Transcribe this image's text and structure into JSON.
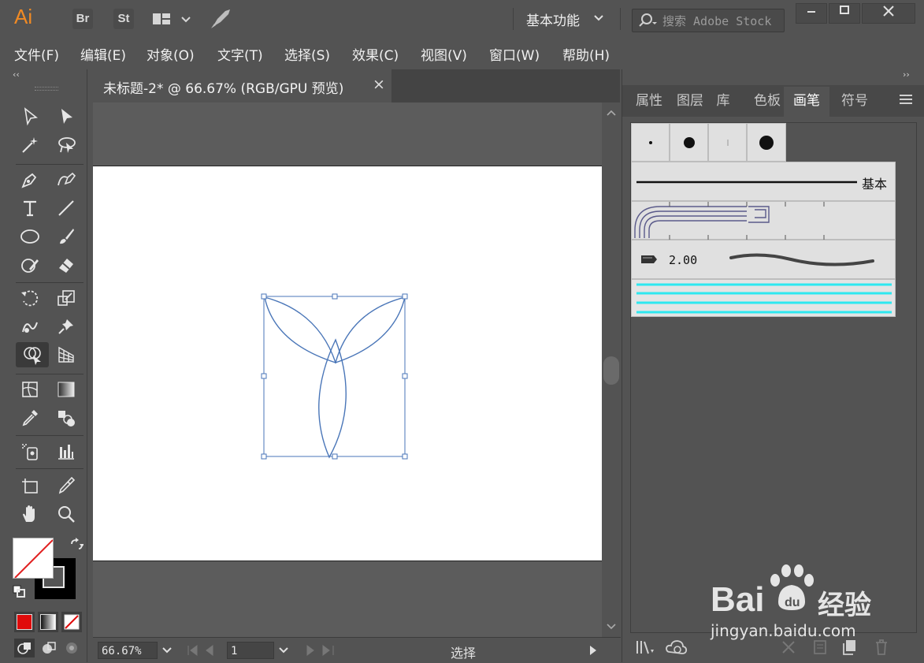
{
  "app": {
    "logo": "Ai",
    "bridge_label": "Br",
    "stock_label": "St",
    "workspace": "基本功能",
    "search_placeholder": "搜索 Adobe Stock"
  },
  "menu": [
    "文件(F)",
    "编辑(E)",
    "对象(O)",
    "文字(T)",
    "选择(S)",
    "效果(C)",
    "视图(V)",
    "窗口(W)",
    "帮助(H)"
  ],
  "document": {
    "tab_title": "未标题-2* @ 66.67% (RGB/GPU 预览)",
    "close_symbol": "×"
  },
  "status": {
    "zoom": "66.67%",
    "artboard_number": "1",
    "tool_name": "选择"
  },
  "panel": {
    "tabs": [
      "属性",
      "图层",
      "库",
      "色板",
      "画笔",
      "符号"
    ],
    "active_tab": "画笔",
    "basic_brush_label": "基本",
    "art_brush_size": "2.00"
  },
  "watermark": {
    "brand": "Bai",
    "brand2": "经验",
    "url": "jingyan.baidu.com"
  },
  "colors": {
    "accent_orange": "#ff9a00",
    "selection_blue": "#4a76b8",
    "cyan_pattern": "#2ee8f0"
  }
}
